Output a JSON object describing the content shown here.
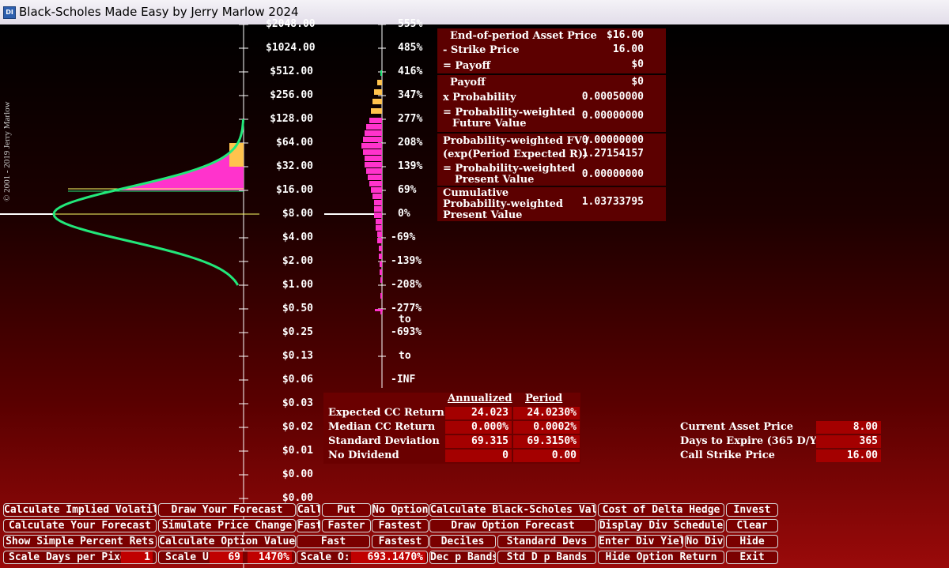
{
  "window": {
    "title": "Black-Scholes Made Easy by Jerry Marlow  2024",
    "icon": "app-icon"
  },
  "copyright": "© 2001 - 2019   Jerry Marlow",
  "price_axis": [
    "$2048.00",
    "$1024.00",
    "$512.00",
    "$256.00",
    "$128.00",
    "$64.00",
    "$32.00",
    "$16.00",
    "$8.00",
    "$4.00",
    "$2.00",
    "$1.00",
    "$0.50",
    "$0.25",
    "$0.13",
    "$0.06",
    "$0.03",
    "$0.02",
    "$0.01",
    "$0.00",
    "$0.00"
  ],
  "return_axis": [
    "555%",
    "485%",
    "416%",
    "347%",
    "277%",
    "208%",
    "139%",
    "69%",
    "0%",
    "-69%",
    "-139%",
    "-208%",
    "-277%",
    "to",
    "-693%",
    "to",
    "-INF"
  ],
  "payoff_panel": {
    "eop_label": "End-of-period Asset Price",
    "eop_value": "$16.00",
    "strike_label": "- Strike Price",
    "strike_value": "16.00",
    "payoff_label": "= Payoff",
    "payoff_value": "$0",
    "payoff2_label": "Payoff",
    "payoff2_value": "$0",
    "prob_label": "x Probability",
    "prob_value": "0.00050000",
    "pwfv_label1": "= Probability-weighted",
    "pwfv_label2": "Future Value",
    "pwfv_value": "0.00000000",
    "pwfv2_label": "Probability-weighted FV /",
    "pwfv2_value": "0.00000000",
    "exp_label": "(exp(Period Expected R))",
    "exp_value": "1.27154157",
    "pwpv_label1": "= Probability-weighted",
    "pwpv_label2": "Present Value",
    "pwpv_value": "0.00000000",
    "cum_label1": "Cumulative",
    "cum_label2": "Probability-weighted",
    "cum_label3": "Present Value",
    "cum_value": "1.03733795"
  },
  "stats_table": {
    "col_annualized": "Annualized",
    "col_period": "Period",
    "rows": [
      {
        "label": "Expected CC Return",
        "annualized": "24.023",
        "period": "24.0230%"
      },
      {
        "label": "Median CC Return",
        "annualized": "0.000%",
        "period": "0.0002%"
      },
      {
        "label": "Standard Deviation",
        "annualized": "69.315",
        "period": "69.3150%"
      },
      {
        "label": "No Dividend",
        "annualized": "0",
        "period": "0.00"
      }
    ]
  },
  "inputs": [
    {
      "label": "Current Asset Price",
      "value": "8.00"
    },
    {
      "label": "Days to Expire (365 D/Y)",
      "value": "365"
    },
    {
      "label": "Call Strike Price",
      "value": "16.00"
    }
  ],
  "buttons": {
    "row1": [
      "Calculate Implied Volatility",
      "Draw Your Forecast",
      "Call",
      "Put",
      "No Option",
      "Calculate Black-Scholes Value",
      "Cost of Delta Hedge",
      "Invest"
    ],
    "row2": [
      "Calculate Your Forecast",
      "Simulate Price Change",
      "Fast",
      "Faster",
      "Fastest",
      "Draw Option Forecast",
      "Display Div Schedule",
      "Clear"
    ],
    "row3": [
      "Show Simple Percent Rets",
      "Calculate Option Value",
      "Fast",
      "Fastest",
      "Deciles",
      "Standard Devs",
      "Enter Div Yield",
      "No Div",
      "Hide"
    ],
    "row4_labels": [
      "Scale Days per Pixel:",
      "Scale U:",
      "Scale O:",
      "Dec p Bands",
      "Std D p Bands",
      "Hide Option Return",
      "Exit"
    ],
    "row4_values": {
      "days_per_pixel": "1",
      "scale_u": "69",
      "scale_u_pct": "1470%",
      "scale_o": "693.1470%"
    }
  },
  "colors": {
    "curve": "#22e87a",
    "pink": "#ff33cc",
    "orange": "#ffc34d",
    "accent": "#a40000",
    "button_bg": "#7a0000"
  }
}
